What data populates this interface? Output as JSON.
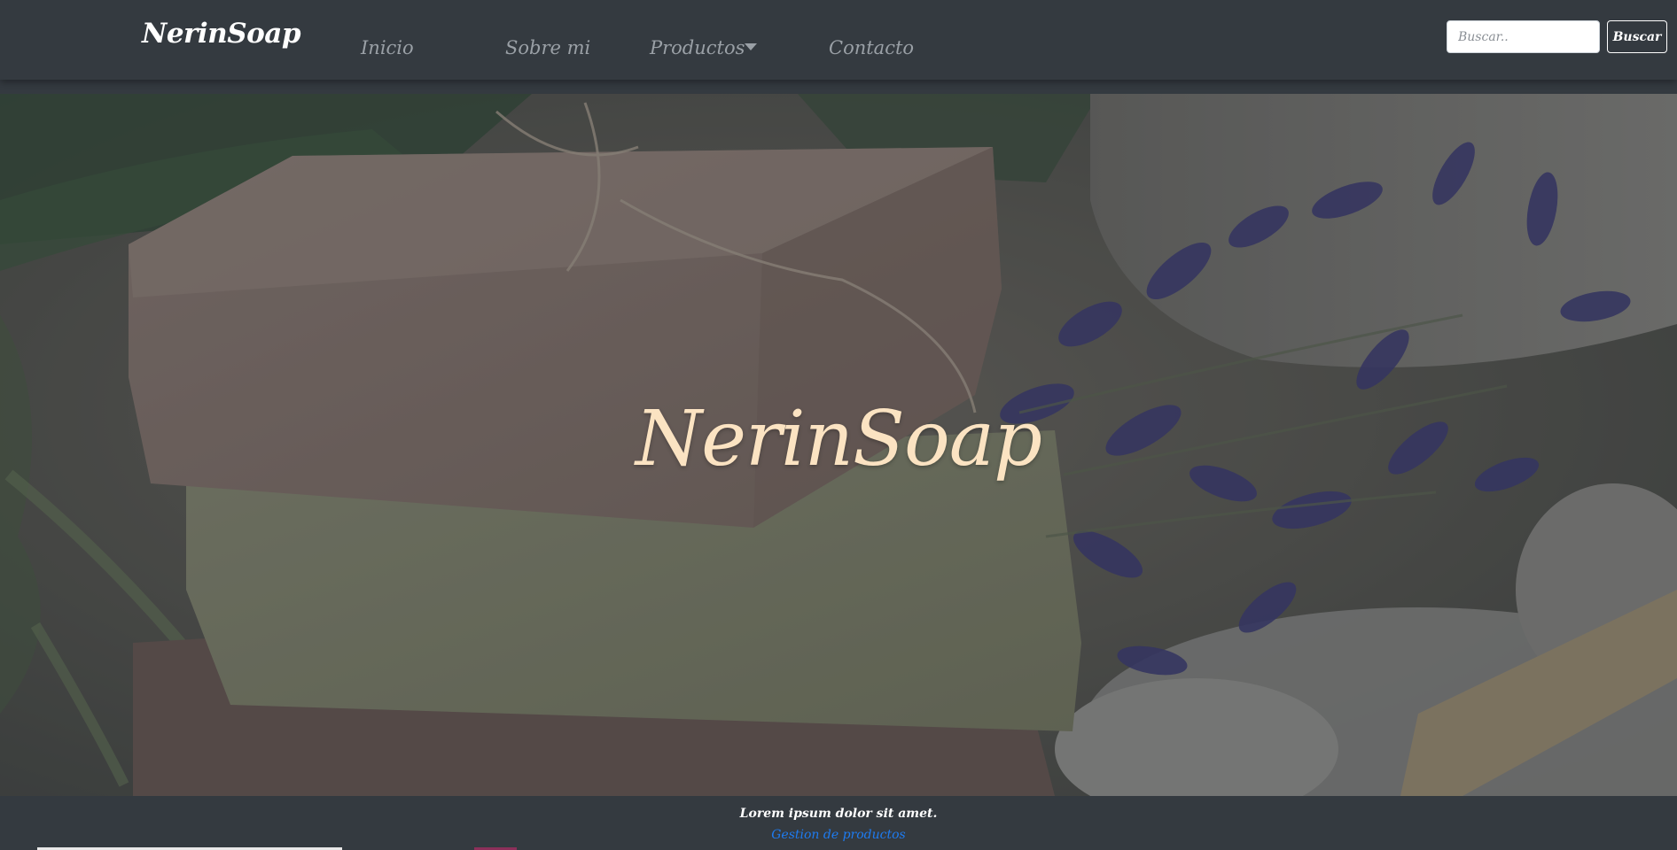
{
  "navbar": {
    "brand": "NerinSoap",
    "links": [
      {
        "label": "Inicio"
      },
      {
        "label": "Sobre mi"
      },
      {
        "label": "Productos",
        "dropdown": true
      },
      {
        "label": "Contacto"
      }
    ],
    "search": {
      "placeholder": "Buscar..",
      "value": "",
      "button_label": "Buscar"
    }
  },
  "hero": {
    "title": "NerinSoap"
  },
  "footer": {
    "text": "Lorem ipsum dolor sit amet.",
    "link": "Gestion de productos"
  },
  "colors": {
    "navbar_bg": "#343a40",
    "hero_title": "#fbe3c2",
    "link_blue": "#1e7bf0",
    "nav_link": "#9aa0a6"
  }
}
